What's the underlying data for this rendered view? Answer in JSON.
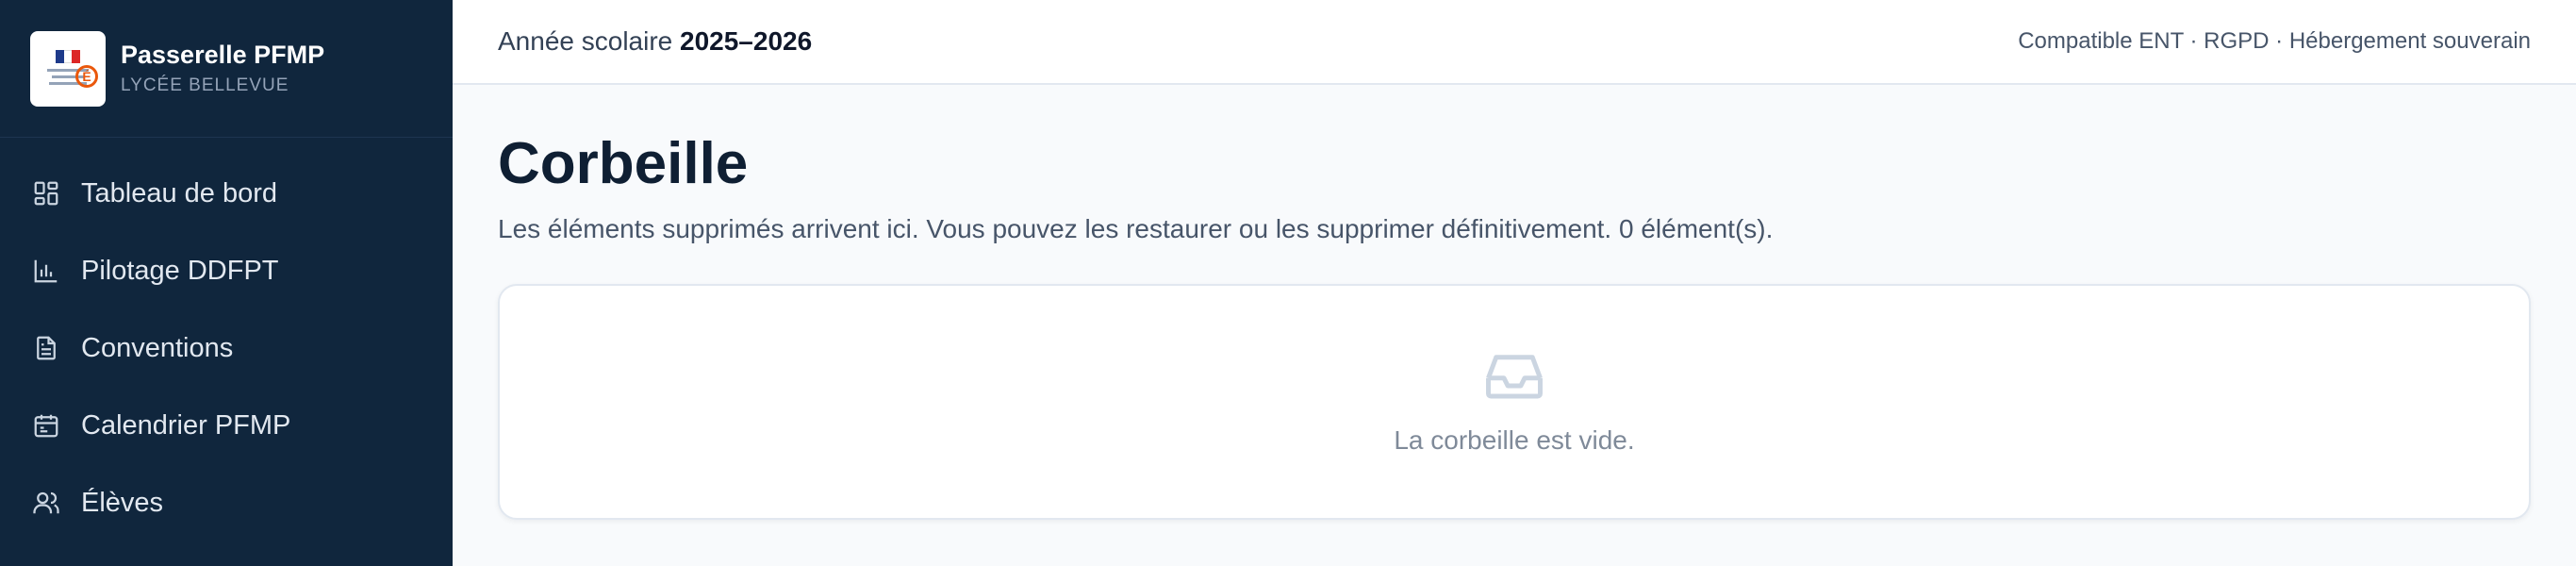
{
  "brand": {
    "title": "Passerelle PFMP",
    "subtitle": "LYCÉE BELLEVUE",
    "logo_mark": "É"
  },
  "sidebar": {
    "items": [
      {
        "label": "Tableau de bord",
        "icon": "dashboard-icon"
      },
      {
        "label": "Pilotage DDFPT",
        "icon": "bar-chart-icon"
      },
      {
        "label": "Conventions",
        "icon": "document-icon"
      },
      {
        "label": "Calendrier PFMP",
        "icon": "calendar-icon"
      },
      {
        "label": "Élèves",
        "icon": "users-icon"
      }
    ]
  },
  "header": {
    "year_label": "Année scolaire",
    "year_value": "2025–2026",
    "compliance": "Compatible ENT · RGPD · Hébergement souverain"
  },
  "main": {
    "title": "Corbeille",
    "description": "Les éléments supprimés arrivent ici. Vous pouvez les restaurer ou les supprimer définitivement. 0 élément(s).",
    "empty_state": {
      "icon": "inbox-icon",
      "text": "La corbeille est vide."
    }
  },
  "colors": {
    "sidebar_bg": "#10263d",
    "page_bg": "#f8fafc",
    "title": "#0f1f33",
    "muted": "#7f8a99"
  }
}
